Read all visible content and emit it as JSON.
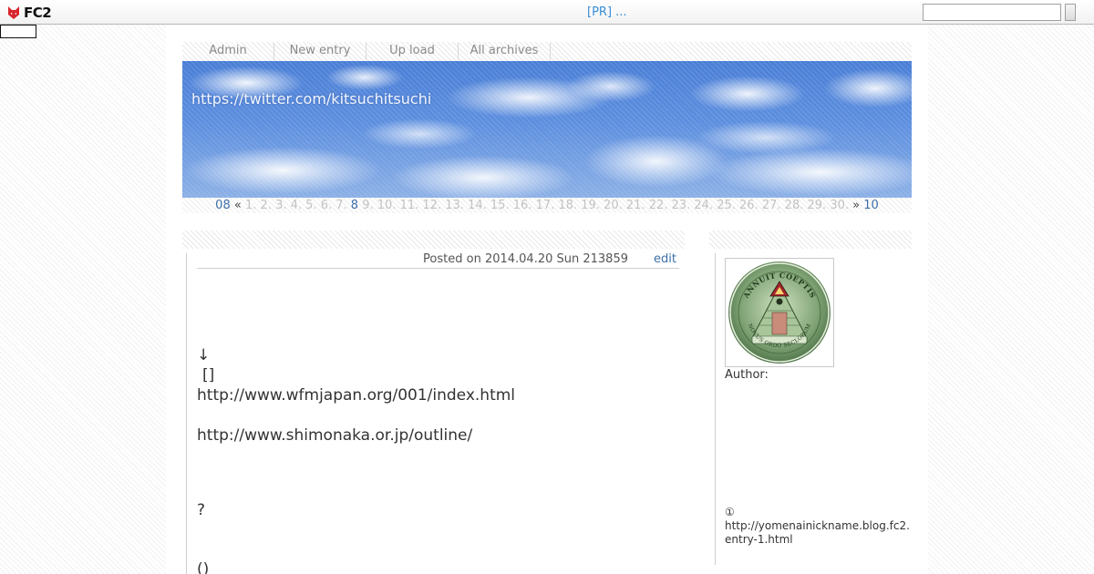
{
  "topbar": {
    "logo_text": "FC2",
    "pr_text": "[PR] ...",
    "search_value": ""
  },
  "nav": {
    "items": [
      {
        "label": "Admin"
      },
      {
        "label": "New entry"
      },
      {
        "label": "Up load"
      },
      {
        "label": "All archives"
      }
    ]
  },
  "header": {
    "title": "https://twitter.com/kitsuchitsuchi"
  },
  "calendar": {
    "prev_month": "08",
    "prev_arrow": "«",
    "days": [
      "1.",
      "2.",
      "3.",
      "4.",
      "5.",
      "6.",
      "7.",
      "8",
      "9.",
      "10.",
      "11.",
      "12.",
      "13.",
      "14.",
      "15.",
      "16.",
      "17.",
      "18.",
      "19.",
      "20.",
      "21.",
      "22.",
      "23.",
      "24.",
      "25.",
      "26.",
      "27.",
      "28.",
      "29.",
      "30."
    ],
    "active_day": "8",
    "next_arrow": "»",
    "next_month": "10"
  },
  "post": {
    "meta": "Posted on 2014.04.20 Sun 213859",
    "edit_label": "edit",
    "lines": {
      "arrow": "↓",
      "brackets": "[]",
      "link1": "http://www.wfmjapan.org/001/index.html",
      "link2": "http://www.shimonaka.or.jp/outline/",
      "question": "?",
      "parens": "()"
    }
  },
  "sidebar": {
    "author_label": "Author:",
    "note_marker": "①",
    "note_link_line1": "http://yomenainickname.blog.fc2.",
    "note_link_line2": "entry-1.html",
    "avatar_text_top": "ANNUIT COEPTIS",
    "avatar_text_bottom": "NOVUS ORDO SECLORUM"
  },
  "colors": {
    "link": "#3d6fa8",
    "pr_link": "#3a8ed6",
    "nav_text": "#8a8a8a",
    "cal_inactive": "#c2c2c2",
    "header_sky": "#5d8fdf"
  }
}
